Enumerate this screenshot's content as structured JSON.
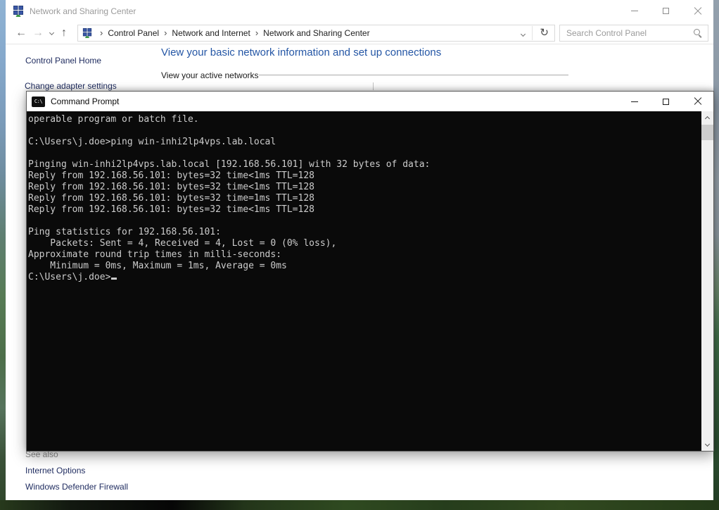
{
  "colors": {
    "heading_blue": "#2456a5",
    "sidebar_link_navy": "#1d2a5e",
    "inactive_title_text": "#9b9b9b",
    "console_bg": "#0a0a0a",
    "console_text": "#cccccc"
  },
  "cp_window": {
    "title": "Network and Sharing Center",
    "breadcrumb": [
      "Control Panel",
      "Network and Internet",
      "Network and Sharing Center"
    ],
    "search_placeholder": "Search Control Panel",
    "sidebar_home": "Control Panel Home",
    "change_adapter_settings": "Change adapter settings",
    "see_also": "See also",
    "internet_options": "Internet Options",
    "windows_defender_firewall": "Windows Defender Firewall",
    "heading": "View your basic network information and set up connections",
    "active_networks_label": "View your active networks"
  },
  "cmd_window": {
    "title": "Command Prompt",
    "cmd_icon_text": "C:\\",
    "console_lines": [
      "operable program or batch file.",
      "",
      "C:\\Users\\j.doe>ping win-inhi2lp4vps.lab.local",
      "",
      "Pinging win-inhi2lp4vps.lab.local [192.168.56.101] with 32 bytes of data:",
      "Reply from 192.168.56.101: bytes=32 time<1ms TTL=128",
      "Reply from 192.168.56.101: bytes=32 time<1ms TTL=128",
      "Reply from 192.168.56.101: bytes=32 time=1ms TTL=128",
      "Reply from 192.168.56.101: bytes=32 time<1ms TTL=128",
      "",
      "Ping statistics for 192.168.56.101:",
      "    Packets: Sent = 4, Received = 4, Lost = 0 (0% loss),",
      "Approximate round trip times in milli-seconds:",
      "    Minimum = 0ms, Maximum = 1ms, Average = 0ms",
      ""
    ],
    "prompt": "C:\\Users\\j.doe>"
  }
}
